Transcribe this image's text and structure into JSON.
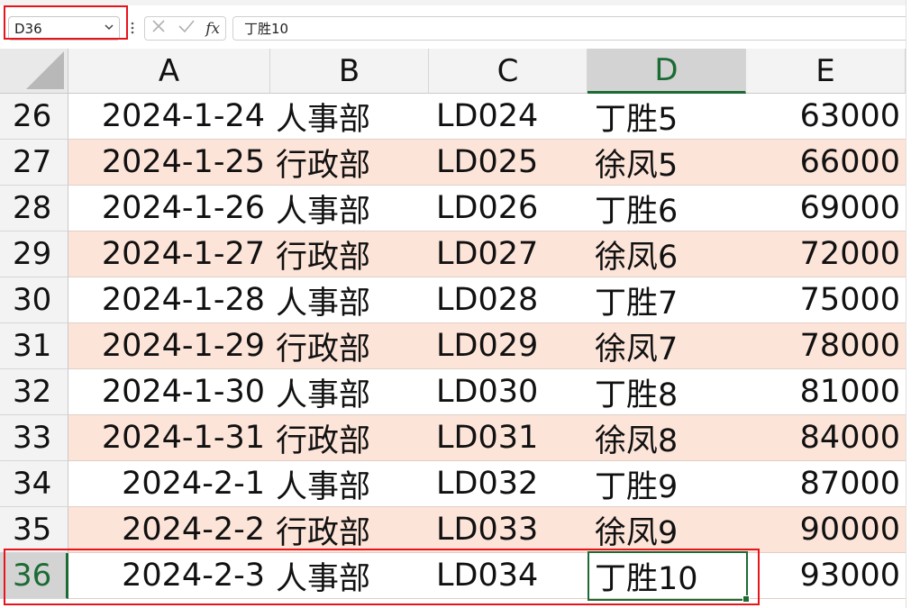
{
  "name_box": {
    "value": "D36",
    "dropdown_icon": "chevron-down-icon"
  },
  "formula_bar": {
    "cancel_icon": "close-icon",
    "enter_icon": "checkmark-icon",
    "fx_label": "fx",
    "content": "丁胜10"
  },
  "columns": [
    "A",
    "B",
    "C",
    "D",
    "E"
  ],
  "active_column": "D",
  "active_row": "36",
  "rows": [
    {
      "num": "26",
      "shaded": false,
      "cells": [
        "2024-1-24",
        "人事部",
        "LD024",
        "丁胜5",
        "63000"
      ]
    },
    {
      "num": "27",
      "shaded": true,
      "cells": [
        "2024-1-25",
        "行政部",
        "LD025",
        "徐凤5",
        "66000"
      ]
    },
    {
      "num": "28",
      "shaded": false,
      "cells": [
        "2024-1-26",
        "人事部",
        "LD026",
        "丁胜6",
        "69000"
      ]
    },
    {
      "num": "29",
      "shaded": true,
      "cells": [
        "2024-1-27",
        "行政部",
        "LD027",
        "徐凤6",
        "72000"
      ]
    },
    {
      "num": "30",
      "shaded": false,
      "cells": [
        "2024-1-28",
        "人事部",
        "LD028",
        "丁胜7",
        "75000"
      ]
    },
    {
      "num": "31",
      "shaded": true,
      "cells": [
        "2024-1-29",
        "行政部",
        "LD029",
        "徐凤7",
        "78000"
      ]
    },
    {
      "num": "32",
      "shaded": false,
      "cells": [
        "2024-1-30",
        "人事部",
        "LD030",
        "丁胜8",
        "81000"
      ]
    },
    {
      "num": "33",
      "shaded": true,
      "cells": [
        "2024-1-31",
        "行政部",
        "LD031",
        "徐凤8",
        "84000"
      ]
    },
    {
      "num": "34",
      "shaded": false,
      "cells": [
        "2024-2-1",
        "人事部",
        "LD032",
        "丁胜9",
        "87000"
      ]
    },
    {
      "num": "35",
      "shaded": true,
      "cells": [
        "2024-2-2",
        "行政部",
        "LD033",
        "徐凤9",
        "90000"
      ]
    },
    {
      "num": "36",
      "shaded": false,
      "cells": [
        "2024-2-3",
        "人事部",
        "LD034",
        "丁胜10",
        "93000"
      ]
    }
  ],
  "colors": {
    "shade": "#fde4d9",
    "active_green": "#1c6b35",
    "highlight_red": "#e8141c"
  }
}
